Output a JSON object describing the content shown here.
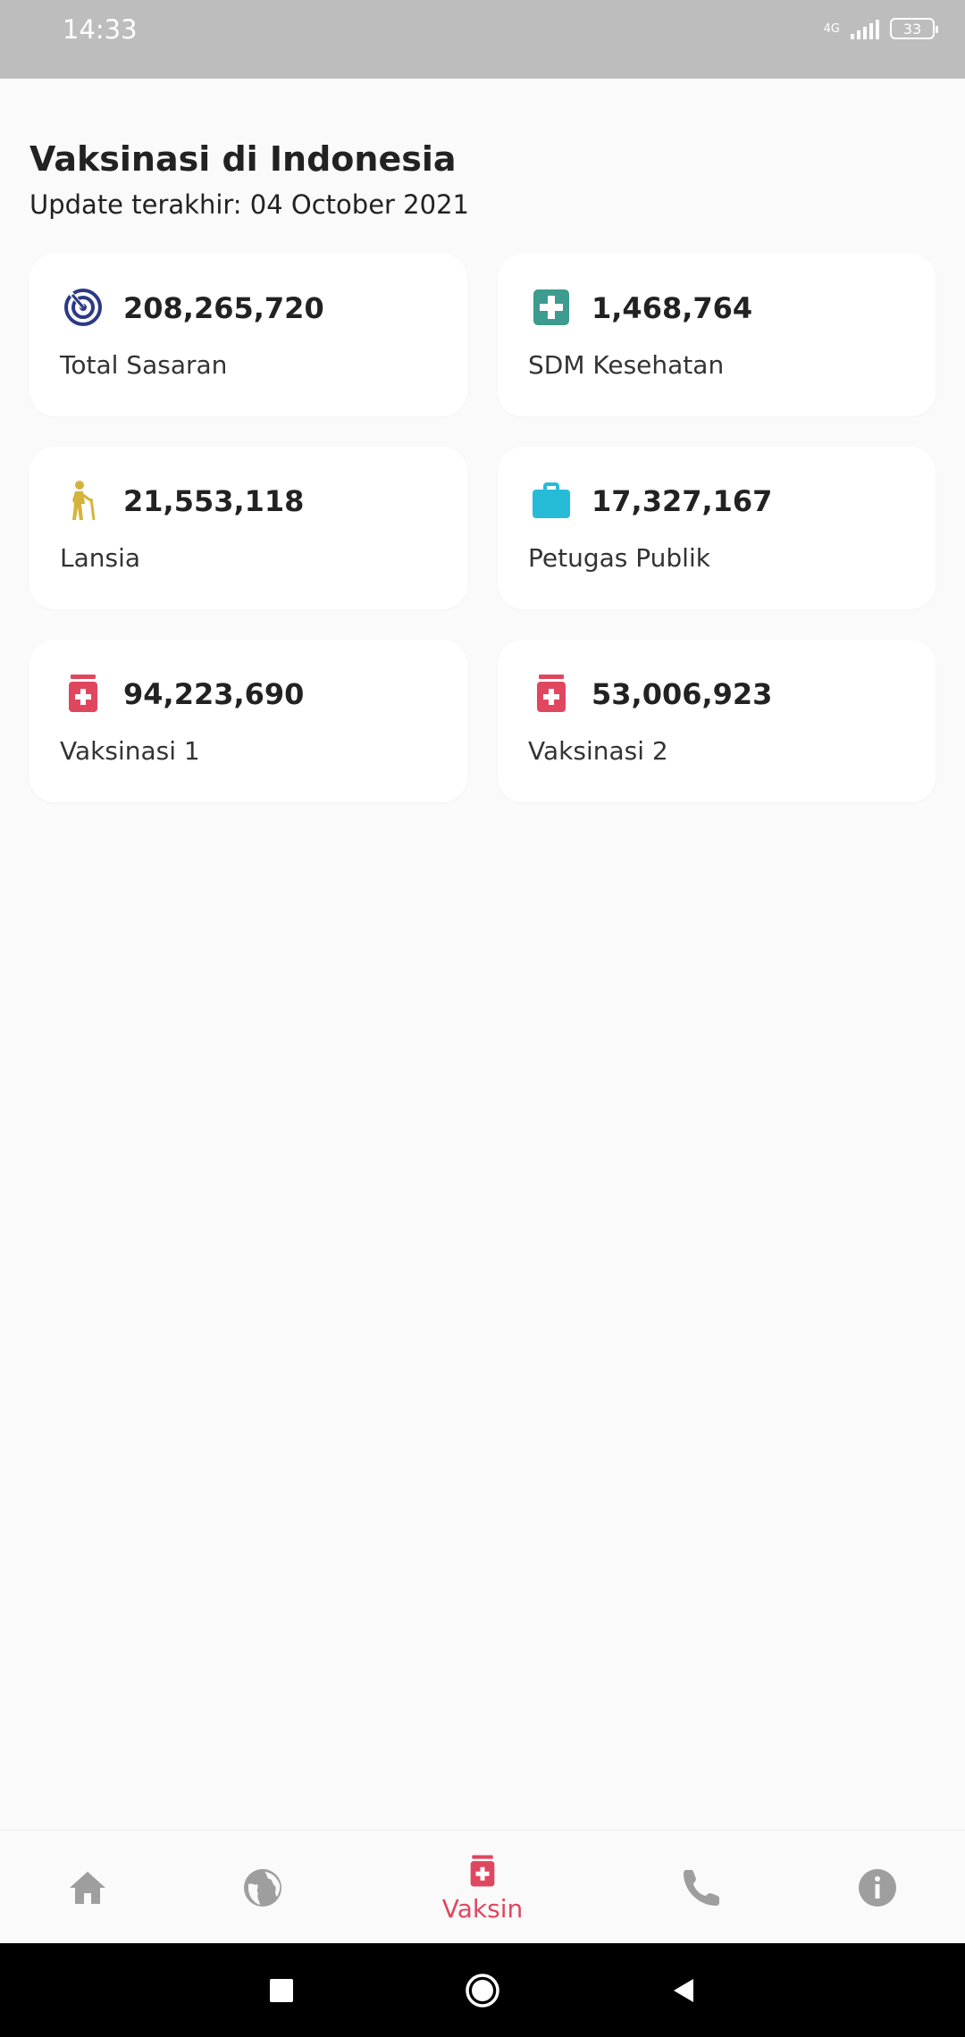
{
  "status_bar": {
    "time": "14:33",
    "network": "4G",
    "battery": "33"
  },
  "header": {
    "title": "Vaksinasi di Indonesia",
    "subtitle": "Update terakhir: 04 October 2021"
  },
  "cards": [
    {
      "value": "208,265,720",
      "label": "Total Sasaran",
      "icon": "target-icon",
      "color": "#2b3a86"
    },
    {
      "value": "1,468,764",
      "label": "SDM Kesehatan",
      "icon": "medical-cross-icon",
      "color": "#3d9b8f"
    },
    {
      "value": "21,553,118",
      "label": "Lansia",
      "icon": "elderly-icon",
      "color": "#d4b33c"
    },
    {
      "value": "17,327,167",
      "label": "Petugas Publik",
      "icon": "briefcase-icon",
      "color": "#26bcd7"
    },
    {
      "value": "94,223,690",
      "label": "Vaksinasi 1",
      "icon": "vaccine-icon",
      "color": "#e0475f"
    },
    {
      "value": "53,006,923",
      "label": "Vaksinasi 2",
      "icon": "vaccine-icon",
      "color": "#e0475f"
    }
  ],
  "bottom_nav": {
    "items": [
      {
        "icon": "home-icon"
      },
      {
        "icon": "globe-icon"
      },
      {
        "icon": "vaccine-icon",
        "label": "Vaksin",
        "active": true
      },
      {
        "icon": "phone-icon"
      },
      {
        "icon": "info-icon"
      }
    ],
    "active_color": "#e0475f",
    "inactive_color": "#9e9e9e"
  },
  "system_nav": {
    "icons": [
      "recents-icon",
      "home-circle-icon",
      "back-icon"
    ]
  }
}
